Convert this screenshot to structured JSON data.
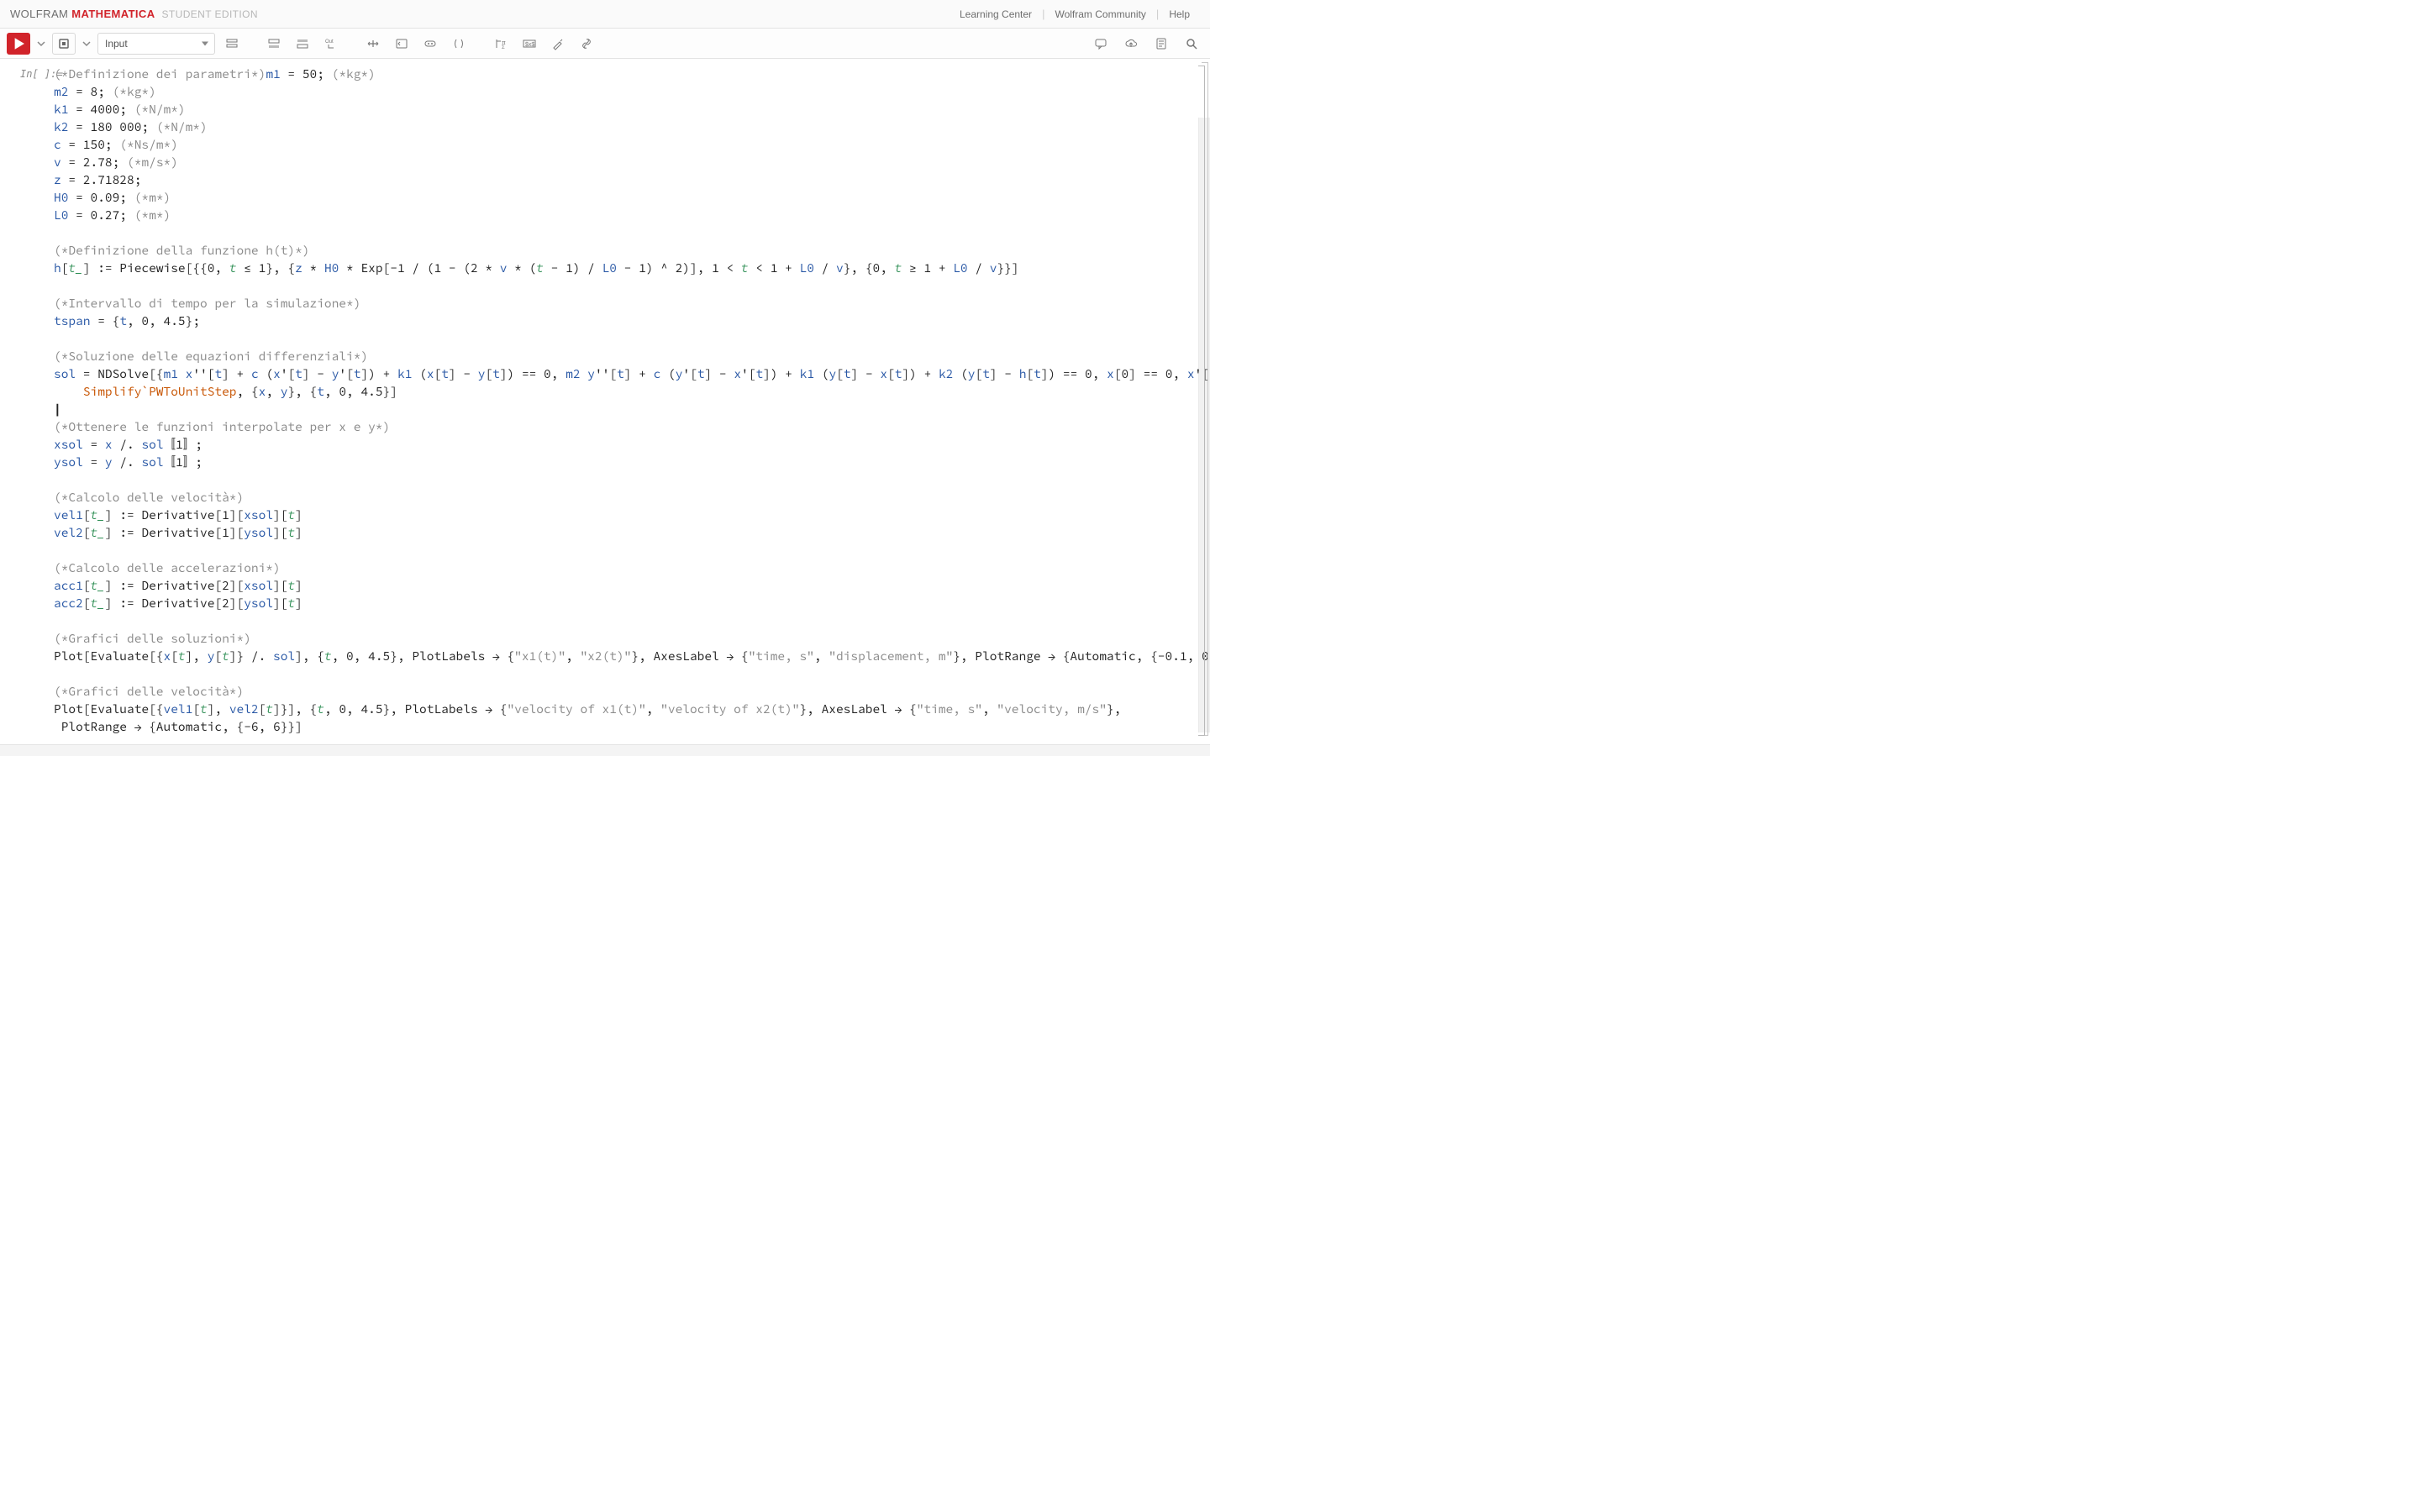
{
  "brand": {
    "wolfram": "WOLFRAM",
    "mathematica": "MATHEMATICA",
    "edition": "STUDENT EDITION"
  },
  "topnav": {
    "learning": "Learning Center",
    "community": "Wolfram Community",
    "help": "Help"
  },
  "style_selector": "Input",
  "in_label": "In[ ]:=",
  "code": {
    "c1a": "(*Definizione dei parametri*)",
    "c1b": "(*kg*)",
    "l1": " m1 = 50; ",
    "l2a": "m2 = 8; ",
    "c2": "(*kg*)",
    "l3a": "k1 = 4000; ",
    "c3": "(*N/m*)",
    "l4a": "k2 = 180 000; ",
    "c4": "(*N/m*)",
    "l5a": "c = 150; ",
    "c5": "(*Ns/m*)",
    "l6a": "v = 2.78; ",
    "c6": "(*m/s*)",
    "l7": "z = 2.71828;",
    "l8a": "H0 = 0.09; ",
    "c8": "(*m*)",
    "l9a": "L0 = 0.27; ",
    "c9": "(*m*)",
    "c10": "(*Definizione della funzione h(t)*)",
    "c12": "(*Intervallo di tempo per la simulazione*)",
    "c14": "(*Soluzione delle equazioni differenziali*)",
    "c17": "(*Ottenere le funzioni interpolate per x e y*)",
    "c20": "(*Calcolo delle velocità*)",
    "c23": "(*Calcolo delle accelerazioni*)",
    "c26": "(*Grafici delle soluzioni*)",
    "c28": "(*Grafici delle velocità*)",
    "s_x1": "\"x1(t)\"",
    "s_x2": "\"x2(t)\"",
    "s_time": "\"time, s\"",
    "s_disp": "\"displacement, m\"",
    "s_v1": "\"velocity of x1(t)\"",
    "s_v2": "\"velocity of x2(t)\"",
    "s_vel": "\"velocity, m/s\""
  }
}
